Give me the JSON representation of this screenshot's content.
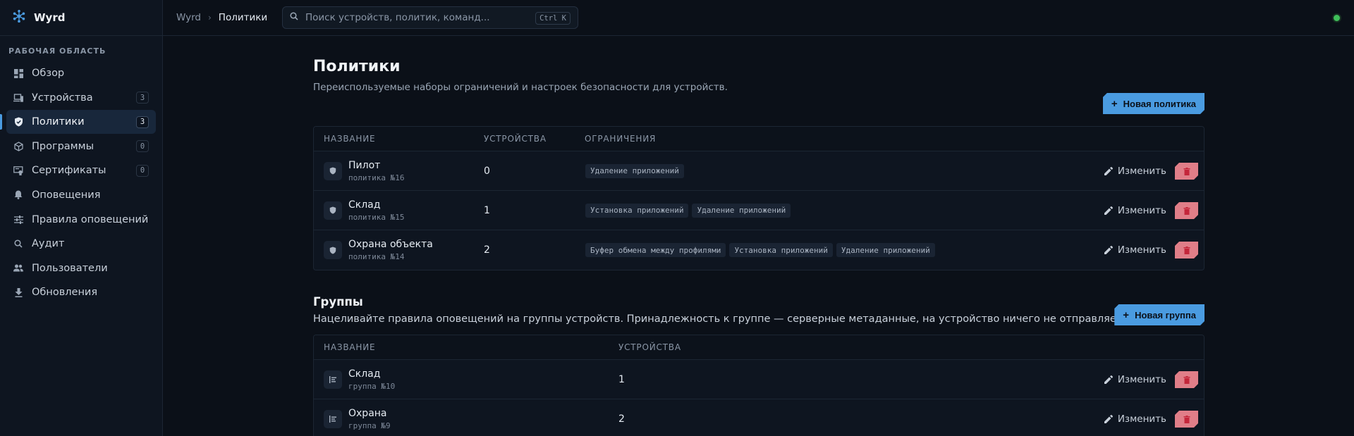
{
  "app": {
    "name": "Wyrd"
  },
  "sidebar": {
    "section_label": "РАБОЧАЯ ОБЛАСТЬ",
    "items": [
      {
        "label": "Обзор",
        "icon": "dashboard-icon",
        "count": null
      },
      {
        "label": "Устройства",
        "icon": "devices-icon",
        "count": "3"
      },
      {
        "label": "Политики",
        "icon": "shield-icon",
        "count": "3",
        "active": true
      },
      {
        "label": "Программы",
        "icon": "package-icon",
        "count": "0"
      },
      {
        "label": "Сертификаты",
        "icon": "certificate-icon",
        "count": "0"
      },
      {
        "label": "Оповещения",
        "icon": "bell-icon",
        "count": null
      },
      {
        "label": "Правила оповещений",
        "icon": "sliders-icon",
        "count": null
      },
      {
        "label": "Аудит",
        "icon": "search-icon",
        "count": null
      },
      {
        "label": "Пользователи",
        "icon": "users-icon",
        "count": null
      },
      {
        "label": "Обновления",
        "icon": "download-icon",
        "count": null
      }
    ]
  },
  "topbar": {
    "breadcrumb_root": "Wyrd",
    "breadcrumb_current": "Политики",
    "search_placeholder": "Поиск устройств, политик, команд...",
    "shortcut": "Ctrl K"
  },
  "policies": {
    "title": "Политики",
    "subtitle": "Переиспользуемые наборы ограничений и настроек безопасности для устройств.",
    "new_button": "Новая политика",
    "columns": [
      "НАЗВАНИЕ",
      "УСТРОЙСТВА",
      "ОГРАНИЧЕНИЯ"
    ],
    "rows": [
      {
        "name": "Пилот",
        "sub": "политика №16",
        "devices": "0",
        "restrictions": [
          "Удаление приложений"
        ]
      },
      {
        "name": "Склад",
        "sub": "политика №15",
        "devices": "1",
        "restrictions": [
          "Установка приложений",
          "Удаление приложений"
        ]
      },
      {
        "name": "Охрана объекта",
        "sub": "политика №14",
        "devices": "2",
        "restrictions": [
          "Буфер обмена между профилями",
          "Установка приложений",
          "Удаление приложений"
        ]
      }
    ]
  },
  "groups": {
    "title": "Группы",
    "subtitle": "Нацеливайте правила оповещений на группы устройств. Принадлежность к группе — серверные метаданные, на устройство ничего не отправляется.",
    "new_button": "Новая группа",
    "columns": [
      "НАЗВАНИЕ",
      "УСТРОЙСТВА"
    ],
    "rows": [
      {
        "name": "Склад",
        "sub": "группа №10",
        "devices": "1"
      },
      {
        "name": "Охрана",
        "sub": "группа №9",
        "devices": "2"
      }
    ]
  },
  "actions": {
    "edit": "Изменить"
  },
  "colors": {
    "accent": "#4a9be0",
    "danger": "#e07e88",
    "status": "#3fbf5a"
  }
}
